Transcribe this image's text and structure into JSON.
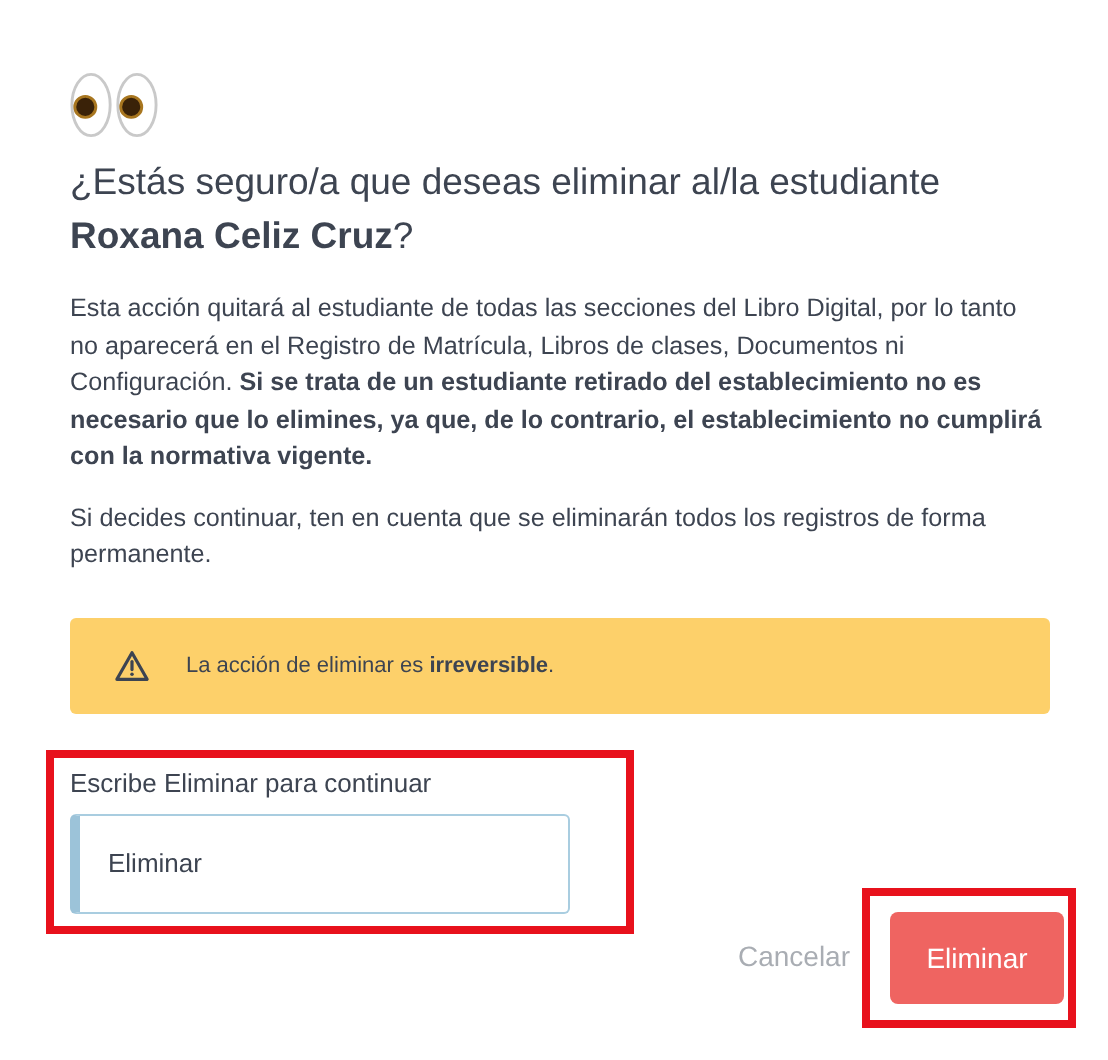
{
  "dialog": {
    "title_prefix": "¿Estás seguro/a que deseas eliminar al/la estudiante",
    "student_name": "Roxana Celiz Cruz",
    "title_suffix": "?",
    "paragraphs": [
      "Esta acción quitará al estudiante de todas las secciones del Libro Digital, por lo tanto no aparecerá en el Registro de Matrícula, Libros de clases, Documentos ni Configuración. **Si se trata de un estudiante retirado del establecimiento no es necesario que lo elimines, ya que, de lo contrario, el establecimiento no cumplirá con la normativa vigente.**",
      "Si decides continuar, ten en cuenta que se eliminarán todos los registros de forma permanente."
    ],
    "alert": {
      "text": "La acción de eliminar es **irreversible**."
    },
    "field": {
      "label": "Escribe Eliminar para continuar",
      "value": "Eliminar",
      "highlighted": true
    },
    "buttons": [
      {
        "kind": "link",
        "label": "Cancelar",
        "highlighted": false
      },
      {
        "kind": "danger",
        "label": "Eliminar",
        "highlighted": true
      }
    ]
  }
}
